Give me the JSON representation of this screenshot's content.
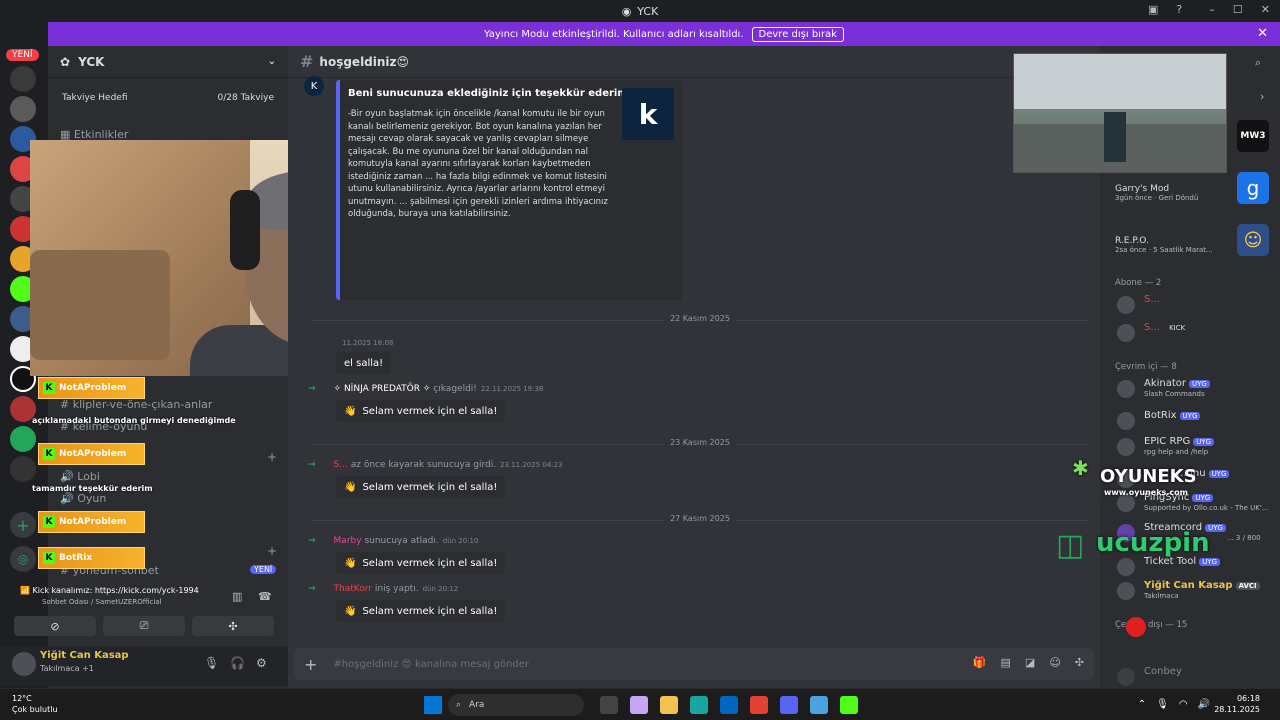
{
  "window": {
    "title": "YCK"
  },
  "banner": {
    "text": "Yayıncı Modu etkinleştirildi. Kullanıcı adları kısaltıldı.",
    "button": "Devre dışı bırak"
  },
  "servers": {
    "new_pill": "YENİ"
  },
  "guild": {
    "name": "YCK",
    "boost_label": "Takviye Hedefi",
    "boost_value": "0/28 Takviye",
    "events": "Etkinlikler",
    "channels": [
      "klipler-ve-öne-çıkan-anlar",
      "kelime-oyunu",
      "Lobi",
      "Oyun",
      "yoneum-sohbet"
    ],
    "new_badge": "YENİ"
  },
  "overlay": {
    "tags": [
      "NotAProblem",
      "NotAProblem",
      "NotAProblem",
      "BotRix"
    ],
    "chat1": "açıklamadaki butondan girmeyi denediğimde",
    "chat2": "tamamdır teşekkür ederim"
  },
  "voice": {
    "line1": "Kick kanalımız: https://kick.com/yck-1994",
    "line2": "Sohbet Odası / SametUZEROfficial"
  },
  "user": {
    "name": "Yiğit Can Kasap",
    "status": "Takılmaca +1"
  },
  "channel": {
    "name": "hoşgeldiniz",
    "emoji": "😍",
    "embed": {
      "title": "Beni sunucunuza eklediğiniz için teşekkür ederim!",
      "desc": "-Bir oyun başlatmak için öncelikle /kanal komutu ile bir oyun kanalı belirlemeniz gerekiyor. Bot oyun kanalına yazılan her mesajı cevap olarak sayacak ve yanlış cevapları silmeye çalışacak. Bu me oyununa özel bir kanal olduğundan nal komutuyla kanal ayarını sıfırlayarak korları kaybetmeden istediğiniz zaman ... ha fazla bilgi edinmek ve komut listesini utunu kullanabilirsiniz. Ayrıca /ayarlar arlarını kontrol etmeyi unutmayın. ... şabilmesi için gerekli izinleri ardıma ihtiyacınız olduğunda, buraya una katılabilirsiniz.",
      "thumb": "k"
    },
    "dividers": [
      "22 Kasım 2025",
      "23 Kasım 2025",
      "27 Kasım 2025"
    ],
    "events": [
      {
        "who": "",
        "text": "el salla!",
        "ts": "11.2025 18:08"
      },
      {
        "who": "✧ NİNJA PREDATÖR ✧",
        "text": "çıkageldi!",
        "ts": "22.11.2025 19:38"
      },
      {
        "who": "S...",
        "text": "az önce kayarak sunucuya girdi.",
        "ts": "23.11.2025 04:23"
      },
      {
        "who": "Marby",
        "text": "sunucuya atladı.",
        "ts": "dün 20:10"
      },
      {
        "who": "ThatKorr",
        "text": "iniş yaptı.",
        "ts": "dün 20:12"
      }
    ],
    "wave_label": "Selam vermek için el salla!",
    "input_placeholder": "#hoşgeldiniz 😍 kanalına mesaj gönder"
  },
  "members": {
    "activities": [
      {
        "game": "Garry's Mod",
        "detail": "3gün önce · Geri Döndü"
      },
      {
        "game": "R.E.P.O.",
        "detail": "2sa önce · 5 Saatlik Marat..."
      }
    ],
    "abone_header": "Abone — 2",
    "abone": [
      {
        "name": "S...",
        "badge": ""
      },
      {
        "name": "S...",
        "badge": "KICK"
      }
    ],
    "online_header": "Çevrim içi — 8",
    "online": [
      {
        "name": "Akinator",
        "badge": "UYG",
        "sub": "Slash Commands"
      },
      {
        "name": "BotRix",
        "badge": "UYG",
        "sub": ""
      },
      {
        "name": "EPIC RPG",
        "badge": "UYG",
        "sub": "rpg help and /help"
      },
      {
        "name": "...unu",
        "badge": "UYG",
        "sub": ""
      },
      {
        "name": "PingSync",
        "badge": "UYG",
        "sub": "Supported by Ollo.co.uk - The UK'..."
      },
      {
        "name": "Streamcord",
        "badge": "UYG",
        "sub": "... 3 / 800"
      },
      {
        "name": "Ticket Tool",
        "badge": "UYG",
        "sub": ""
      },
      {
        "name": "Yiğit Can Kasap",
        "badge": "AVCI",
        "sub": "Takılmaca"
      }
    ],
    "offline_header": "Çevrim dışı — 15",
    "offline": [
      "Conbey"
    ]
  },
  "watermarks": {
    "brand1": "OYUNEKS",
    "brand1_sub": "www.oyuneks.com",
    "brand2": "ucuzpin"
  },
  "taskbar": {
    "temp": "12°C",
    "weather": "Çok bulutlu",
    "search": "Ara",
    "time": "06:18",
    "date": "28.11.2025"
  }
}
